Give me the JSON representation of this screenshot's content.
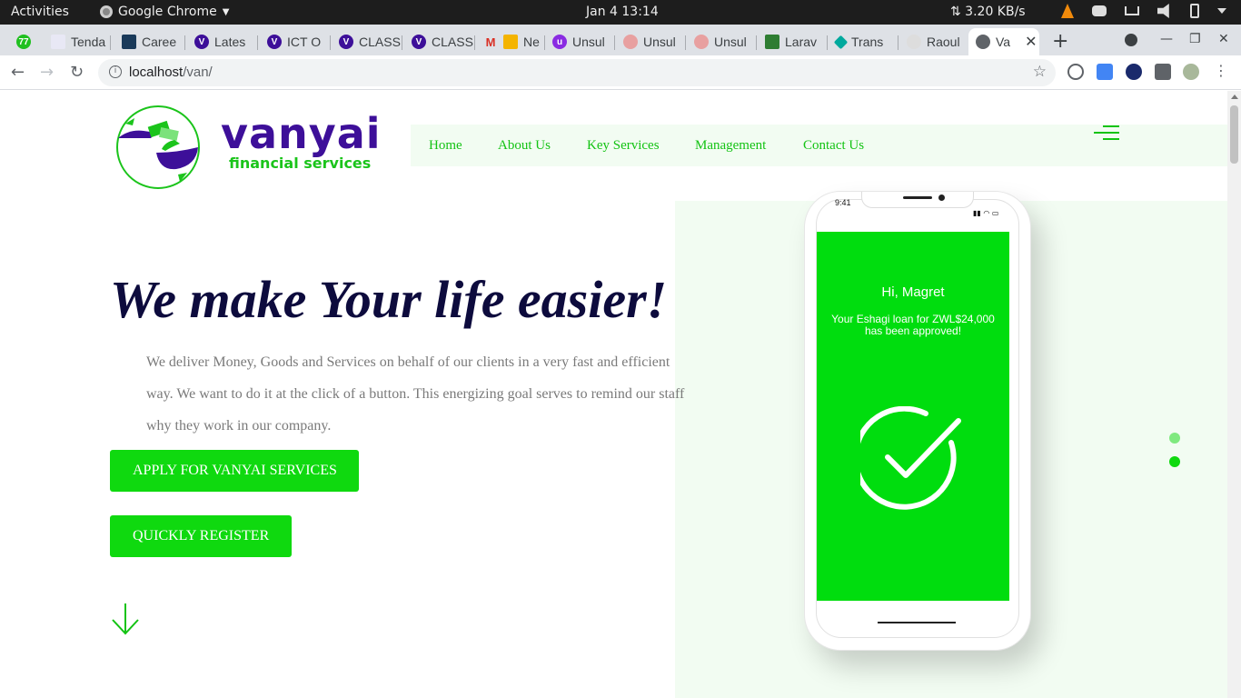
{
  "system": {
    "activities": "Activities",
    "app_name": "Google Chrome",
    "clock": "Jan 4  13:14",
    "net_speed": "⇅ 3.20 KB/s"
  },
  "tabs": [
    {
      "label": "",
      "color": "#20c020"
    },
    {
      "label": "Tenda",
      "color": "#6b6ba8"
    },
    {
      "label": "Caree",
      "color": "#1a3a5a"
    },
    {
      "label": "Lates",
      "color": "#3d0f99"
    },
    {
      "label": "ICT O",
      "color": "#3d0f99"
    },
    {
      "label": "CLASS",
      "color": "#3d0f99"
    },
    {
      "label": "CLASS",
      "color": "#3d0f99"
    },
    {
      "label": "Ne",
      "color": "#d93025"
    },
    {
      "label": "Unsul",
      "color": "#8a2be2"
    },
    {
      "label": "Unsul",
      "color": "#c0392b"
    },
    {
      "label": "Unsul",
      "color": "#c0392b"
    },
    {
      "label": "Larav",
      "color": "#2e7d32"
    },
    {
      "label": "Trans",
      "color": "#00a99d"
    },
    {
      "label": "Raoul",
      "color": "#999999"
    },
    {
      "label": "Va",
      "color": "#5f6368"
    }
  ],
  "address": {
    "host": "localhost",
    "path": "/van/"
  },
  "site": {
    "brand": "vanyai",
    "brand_sub": "financial services",
    "nav": [
      "Home",
      "About Us",
      "Key Services",
      "Management",
      "Contact Us"
    ],
    "headline": "We make Your life easier!",
    "description": "We deliver Money, Goods and Services on behalf of our clients in a very fast and efficient way. We want to do it at the click of a button. This energizing goal serves to remind our staff why they work in our company.",
    "apply_button": "APPLY FOR VANYAI SERVICES",
    "register_button": "QUICKLY REGISTER",
    "accent": "#0fd90f",
    "brand_color": "#3d0f99"
  },
  "phone": {
    "time": "9:41",
    "greeting": "Hi, Magret",
    "message": "Your Eshagi loan for ZWL$24,000 has been approved!"
  },
  "icons": {
    "back": "arrow-left-icon",
    "forward": "arrow-right-icon",
    "reload": "reload-icon",
    "bookmark": "star-icon",
    "scroll": "arrow-down-icon"
  }
}
